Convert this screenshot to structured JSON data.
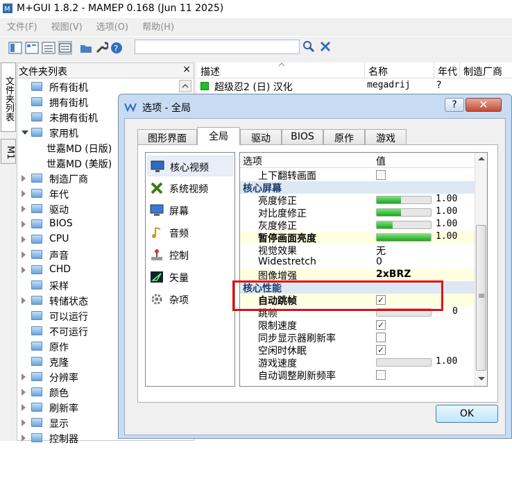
{
  "window": {
    "title": "M+GUI 1.8.2 - MAMEP 0.168 (Jun 11 2025)"
  },
  "menu": [
    "文件(F)",
    "视图(V)",
    "选项(O)",
    "帮助(H)"
  ],
  "toolbar": {
    "search_value": ""
  },
  "side_tabs": [
    "文件夹列表",
    "M1"
  ],
  "folder_panel": {
    "title": "文件夹列表",
    "close": "×",
    "items": [
      {
        "label": "所有街机",
        "arrow": ""
      },
      {
        "label": "拥有街机",
        "arrow": ""
      },
      {
        "label": "未拥有街机",
        "arrow": ""
      },
      {
        "label": "家用机",
        "arrow": "open"
      },
      {
        "label": "世嘉MD (日版)",
        "arrow": "",
        "child": true
      },
      {
        "label": "世嘉MD (美版)",
        "arrow": "",
        "child": true
      },
      {
        "label": "制造厂商",
        "arrow": "closed"
      },
      {
        "label": "年代",
        "arrow": "closed"
      },
      {
        "label": "驱动",
        "arrow": "closed"
      },
      {
        "label": "BIOS",
        "arrow": "closed"
      },
      {
        "label": "CPU",
        "arrow": "closed"
      },
      {
        "label": "声音",
        "arrow": "closed"
      },
      {
        "label": "CHD",
        "arrow": "closed"
      },
      {
        "label": "采样",
        "arrow": ""
      },
      {
        "label": "转储状态",
        "arrow": "closed"
      },
      {
        "label": "可以运行",
        "arrow": ""
      },
      {
        "label": "不可运行",
        "arrow": ""
      },
      {
        "label": "原作",
        "arrow": ""
      },
      {
        "label": "克隆",
        "arrow": ""
      },
      {
        "label": "分辨率",
        "arrow": "closed"
      },
      {
        "label": "颜色",
        "arrow": "closed"
      },
      {
        "label": "刷新率",
        "arrow": "closed"
      },
      {
        "label": "显示",
        "arrow": "closed"
      },
      {
        "label": "控制器",
        "arrow": "closed"
      }
    ]
  },
  "game_list": {
    "columns": [
      "描述",
      "名称",
      "年代",
      "制造厂商"
    ],
    "rows": [
      {
        "desc": "超级忍2 (日) 汉化",
        "name": "megadrij",
        "year": "?"
      }
    ]
  },
  "dialog": {
    "title": "选项 - 全局",
    "help": "?",
    "close": "✕",
    "tabs": [
      "图形界面",
      "全局",
      "驱动",
      "BIOS",
      "原作",
      "游戏"
    ],
    "active_tab": "全局",
    "categories": [
      "核心视频",
      "系统视频",
      "屏幕",
      "音频",
      "控制",
      "矢量",
      "杂项"
    ],
    "selected_category": "核心视频",
    "grid_headers": {
      "option": "选项",
      "value": "值"
    },
    "rows": [
      {
        "type": "check",
        "name": "上下翻转画面",
        "checked": false
      },
      {
        "type": "section",
        "name": "核心屏幕"
      },
      {
        "type": "slider",
        "name": "亮度修正",
        "level": 0.45,
        "value": "1.00"
      },
      {
        "type": "slider",
        "name": "对比度修正",
        "level": 0.45,
        "value": "1.00"
      },
      {
        "type": "slider",
        "name": "灰度修正",
        "level": 0.3,
        "value": "1.00"
      },
      {
        "type": "slider",
        "name": "暂停画面亮度",
        "level": 1.0,
        "value": "1.00",
        "highlight": true
      },
      {
        "type": "text",
        "name": "视觉效果",
        "value": "无"
      },
      {
        "type": "text",
        "name": "Widestretch",
        "value": "0"
      },
      {
        "type": "text",
        "name": "图像增强",
        "value": "2xBRZ",
        "highlight": true
      },
      {
        "type": "section",
        "name": "核心性能"
      },
      {
        "type": "check",
        "name": "自动跳帧",
        "checked": true,
        "highlight": true
      },
      {
        "type": "slider",
        "name": "跳帧",
        "level": 0.0,
        "value": "0"
      },
      {
        "type": "check",
        "name": "限制速度",
        "checked": true
      },
      {
        "type": "check",
        "name": "同步显示器刷新率",
        "checked": false
      },
      {
        "type": "check",
        "name": "空闲时休眠",
        "checked": true
      },
      {
        "type": "slider",
        "name": "游戏速度",
        "level": 0.0,
        "value": "1.00"
      },
      {
        "type": "check",
        "name": "自动调整刷新频率",
        "checked": false
      }
    ],
    "ok": "OK"
  },
  "colors": {
    "accent": "#16a816",
    "highlight_box": "#e01010",
    "section_bg": "#dde8f3"
  }
}
